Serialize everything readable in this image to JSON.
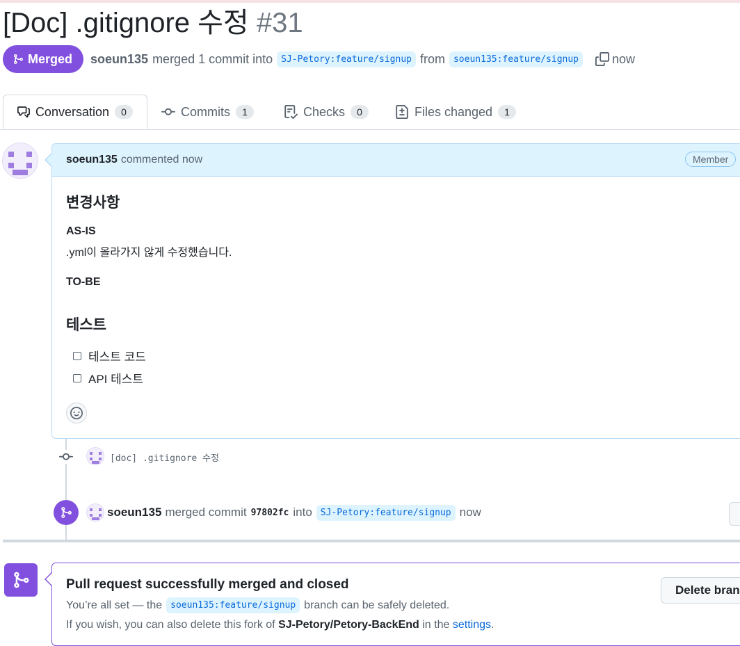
{
  "pr": {
    "title": "[Doc] .gitignore 수정",
    "number": "#31",
    "state_label": "Merged",
    "author": "soeun135",
    "merge_text": "merged 1 commit into",
    "base_branch": "SJ-Petory:feature/signup",
    "from_text": "from",
    "head_branch": "soeun135:feature/signup",
    "time": "now"
  },
  "tabs": [
    {
      "label": "Conversation",
      "count": "0"
    },
    {
      "label": "Commits",
      "count": "1"
    },
    {
      "label": "Checks",
      "count": "0"
    },
    {
      "label": "Files changed",
      "count": "1"
    }
  ],
  "comment": {
    "author": "soeun135",
    "action": "commented now",
    "role_badge": "Member",
    "heading1": "변경사항",
    "as_is_label": "AS-IS",
    "as_is_text": ".yml이 올라가지 않게 수정했습니다.",
    "to_be_label": "TO-BE",
    "heading2": "테스트",
    "tasks": [
      "테스트 코드",
      "API 테스트"
    ]
  },
  "timeline": {
    "commit_message": "[doc] .gitignore 수정",
    "merge_event": {
      "author": "soeun135",
      "text1": "merged commit",
      "sha": "97802fc",
      "text2": "into",
      "branch": "SJ-Petory:feature/signup",
      "time": "now"
    }
  },
  "merge_status": {
    "title": "Pull request successfully merged and closed",
    "sub_prefix": "You’re all set — the",
    "sub_branch": "soeun135:feature/signup",
    "sub_suffix": "branch can be safely deleted.",
    "fork_prefix": "If you wish, you can also delete this fork of",
    "fork_repo": "SJ-Petory/Petory-BackEnd",
    "fork_middle": "in the",
    "fork_link": "settings",
    "fork_end": ".",
    "delete_button": "Delete branch"
  },
  "colors": {
    "merged_purple": "#8250df",
    "link_blue": "#0969da",
    "comment_header_bg": "#ddf4ff"
  }
}
